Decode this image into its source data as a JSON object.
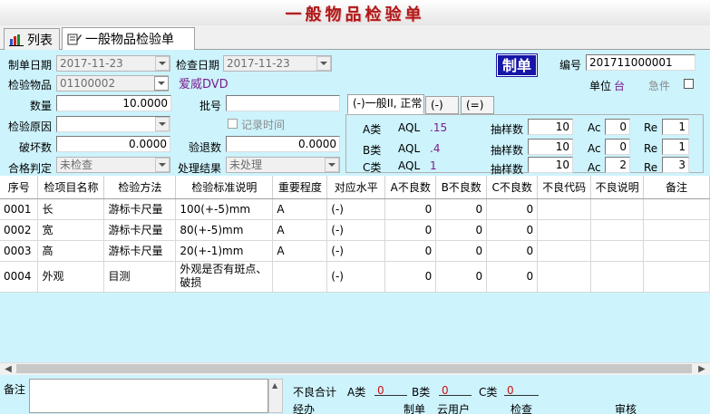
{
  "window": {
    "title": "一般物品检验单"
  },
  "tabs": [
    {
      "label": "列表"
    },
    {
      "label": "一般物品检验单"
    }
  ],
  "form": {
    "make_date_label": "制单日期",
    "make_date": "2017-11-23",
    "check_date_label": "检查日期",
    "check_date": "2017-11-23",
    "status_badge": "制单",
    "number_label": "编号",
    "number": "201711000001",
    "item_label": "检验物品",
    "item_code": "01100002",
    "item_name": "爱威DVD",
    "unit_label": "单位",
    "unit": "台",
    "urgent_label": "急件",
    "qty_label": "数量",
    "qty": "10.0000",
    "batch_label": "批号",
    "batch": "",
    "reason_label": "检验原因",
    "reason": "",
    "record_time_label": "记录时间",
    "damaged_label": "破坏数",
    "damaged": "0.0000",
    "returned_label": "验退数",
    "returned": "0.0000",
    "judgement_label": "合格判定",
    "judgement": "未检查",
    "result_label": "处理结果",
    "result": "未处理"
  },
  "aql": {
    "tabs": [
      "(-)一般II, 正常",
      "(-)",
      "(=)"
    ],
    "rows": [
      {
        "cls": "A类",
        "aql_label": "AQL",
        "aql": ".15",
        "sample_label": "抽样数",
        "sample": "10",
        "ac_label": "Ac",
        "ac": "0",
        "re_label": "Re",
        "re": "1"
      },
      {
        "cls": "B类",
        "aql_label": "AQL",
        "aql": ".4",
        "sample_label": "抽样数",
        "sample": "10",
        "ac_label": "Ac",
        "ac": "0",
        "re_label": "Re",
        "re": "1"
      },
      {
        "cls": "C类",
        "aql_label": "AQL",
        "aql": "1",
        "sample_label": "抽样数",
        "sample": "10",
        "ac_label": "Ac",
        "ac": "2",
        "re_label": "Re",
        "re": "3"
      }
    ]
  },
  "table": {
    "columns": [
      "序号",
      "检项目名称",
      "检验方法",
      "检验标准说明",
      "重要程度",
      "对应水平",
      "A不良数",
      "B不良数",
      "C不良数",
      "不良代码",
      "不良说明",
      "备注"
    ],
    "rows": [
      [
        "0001",
        "长",
        "游标卡尺量",
        "100(+-5)mm",
        "A",
        "(-)",
        "0",
        "0",
        "0",
        "",
        "",
        ""
      ],
      [
        "0002",
        "宽",
        "游标卡尺量",
        "80(+-5)mm",
        "A",
        "(-)",
        "0",
        "0",
        "0",
        "",
        "",
        ""
      ],
      [
        "0003",
        "高",
        "游标卡尺量",
        "20(+-1)mm",
        "A",
        "(-)",
        "0",
        "0",
        "0",
        "",
        "",
        ""
      ],
      [
        "0004",
        "外观",
        "目测",
        "外观是否有斑点、破损",
        "",
        "(-)",
        "0",
        "0",
        "0",
        "",
        "",
        ""
      ]
    ]
  },
  "footer": {
    "memo_label": "备注",
    "defect_total_label": "不良合计",
    "a_label": "A类",
    "a_value": "0",
    "b_label": "B类",
    "b_value": "0",
    "c_label": "C类",
    "c_value": "0",
    "handler_label": "经办",
    "maker_label": "制单",
    "maker": "云用户",
    "inspector_label": "检查",
    "reviewer_label": "审核"
  }
}
